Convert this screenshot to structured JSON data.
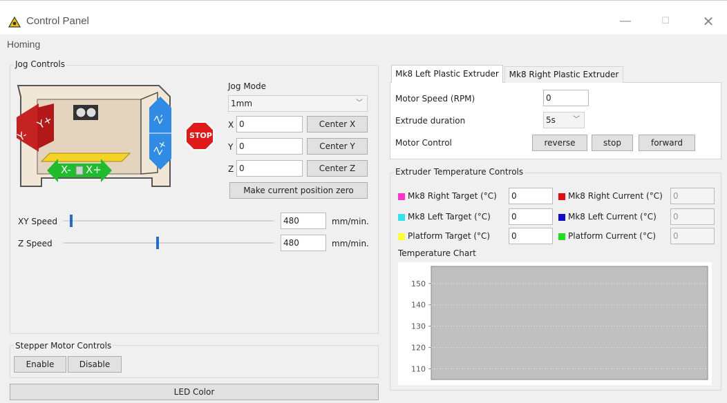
{
  "window": {
    "title": "Control Panel",
    "minimize_glyph": "—",
    "maximize_glyph": "☐",
    "close_glyph": "✕",
    "icon": "warning-triangle-icon"
  },
  "menu": {
    "homing": "Homing"
  },
  "jog": {
    "title": "Jog Controls",
    "mode_label": "Jog Mode",
    "mode_value": "1mm",
    "x_label": "X",
    "x_value": "0",
    "center_x": "Center X",
    "y_label": "Y",
    "y_value": "0",
    "center_y": "Center Y",
    "z_label": "Z",
    "z_value": "0",
    "center_z": "Center Z",
    "make_zero": "Make current position zero",
    "stop_label": "STOP",
    "arrows": {
      "y_minus": "Y-",
      "y_plus": "Y+",
      "x_minus": "X-",
      "x_plus": "X+",
      "z_minus": "Z-",
      "z_plus": "Z+"
    },
    "xy_speed_label": "XY Speed",
    "xy_speed_value": "480",
    "xy_speed_unit": "mm/min.",
    "xy_speed_fraction": 0.03,
    "z_speed_label": "Z Speed",
    "z_speed_value": "480",
    "z_speed_unit": "mm/min.",
    "z_speed_fraction": 0.44
  },
  "stepper": {
    "title": "Stepper Motor Controls",
    "enable": "Enable",
    "disable": "Disable"
  },
  "led": {
    "label": "LED Color"
  },
  "extruder_tabs": {
    "left": "Mk8 Left Plastic Extruder",
    "right": "Mk8 Right Plastic Extruder",
    "motor_speed_label": "Motor Speed (RPM)",
    "motor_speed_value": "0",
    "extrude_duration_label": "Extrude duration",
    "extrude_duration_value": "5s",
    "motor_control_label": "Motor Control",
    "reverse": "reverse",
    "stop": "stop",
    "forward": "forward"
  },
  "temperature": {
    "title": "Extruder Temperature Controls",
    "right_target_label": "Mk8 Right Target (°C)",
    "right_target_value": "0",
    "right_current_label": "Mk8 Right Current (°C)",
    "right_current_value": "0",
    "left_target_label": "Mk8 Left Target (°C)",
    "left_target_value": "0",
    "left_current_label": "Mk8 Left Current (°C)",
    "left_current_value": "0",
    "platform_target_label": "Platform Target (°C)",
    "platform_target_value": "0",
    "platform_current_label": "Platform Current (°C)",
    "platform_current_value": "0",
    "colors": {
      "right_target": "#ff33cc",
      "right_current": "#e01010",
      "left_target": "#33e0ee",
      "left_current": "#1010c8",
      "platform_target": "#ffff33",
      "platform_current": "#22dd22"
    },
    "chart_title": "Temperature Chart"
  },
  "chart_data": {
    "type": "line",
    "title": "Temperature Chart",
    "xlabel": "",
    "ylabel": "",
    "yticks": [
      110,
      120,
      130,
      140,
      150
    ],
    "ylim": [
      105,
      158
    ],
    "series": [],
    "grid": true,
    "plot_background": "#c0c0c0"
  }
}
